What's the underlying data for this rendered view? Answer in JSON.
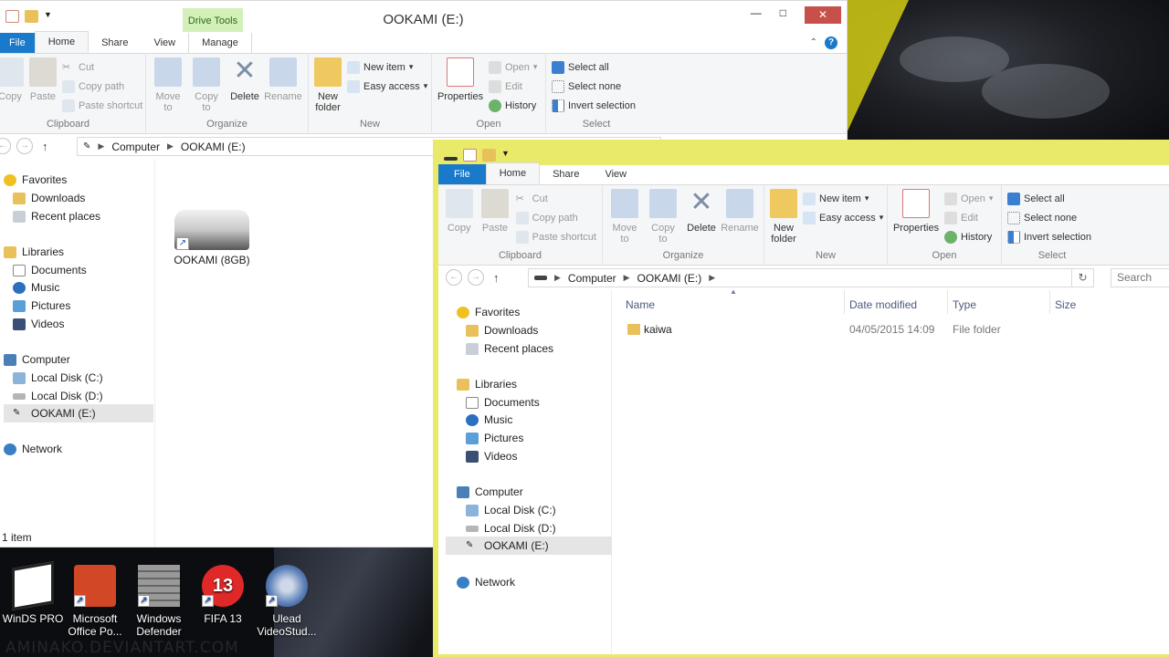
{
  "watermark": "AMINAKO.DEVIANTART.COM",
  "desktop_icons": [
    {
      "label": "WinDS PRO",
      "icon": "winds-pro-icon",
      "color": "#ffffff"
    },
    {
      "label": "Microsoft Office Po...",
      "icon": "powerpoint-icon",
      "color": "#d24726"
    },
    {
      "label": "Windows Defender",
      "icon": "defender-icon",
      "color": "#8a8a8a"
    },
    {
      "label": "FIFA 13",
      "icon": "fifa-icon",
      "color": "#e02828"
    },
    {
      "label": "Ulead VideoStud...",
      "icon": "videostudio-icon",
      "color": "#5a7fb8"
    }
  ],
  "back_window": {
    "title": "OOKAMI (E:)",
    "context_tab": "Drive Tools",
    "tabs": [
      "File",
      "Home",
      "Share",
      "View",
      "Manage"
    ],
    "address": [
      "Computer",
      "OOKAMI (E:)"
    ],
    "drive_label": "OOKAMI (8GB)",
    "status": "1 item"
  },
  "front_window": {
    "tabs": [
      "File",
      "Home",
      "Share",
      "View"
    ],
    "address": [
      "Computer",
      "OOKAMI (E:)"
    ],
    "search_placeholder": "Search",
    "columns": [
      "Name",
      "Date modified",
      "Type",
      "Size"
    ],
    "rows": [
      {
        "name": "kaiwa",
        "modified": "04/05/2015 14:09",
        "type": "File folder",
        "size": ""
      }
    ]
  },
  "ribbon": {
    "clipboard": {
      "label": "Clipboard",
      "copy": "Copy",
      "paste": "Paste",
      "cut": "Cut",
      "copy_path": "Copy path",
      "paste_shortcut": "Paste shortcut"
    },
    "organize": {
      "label": "Organize",
      "move_to": "Move to",
      "copy_to": "Copy to",
      "delete": "Delete",
      "rename": "Rename"
    },
    "new": {
      "label": "New",
      "new_folder": "New folder",
      "new_item": "New item",
      "easy_access": "Easy access"
    },
    "open": {
      "label": "Open",
      "properties": "Properties",
      "open": "Open",
      "edit": "Edit",
      "history": "History"
    },
    "select": {
      "label": "Select",
      "select_all": "Select all",
      "select_none": "Select none",
      "invert": "Invert selection"
    }
  },
  "nav": {
    "favorites": "Favorites",
    "downloads": "Downloads",
    "recent": "Recent places",
    "libraries": "Libraries",
    "documents": "Documents",
    "music": "Music",
    "pictures": "Pictures",
    "videos": "Videos",
    "computer": "Computer",
    "local_c": "Local Disk (C:)",
    "local_d": "Local Disk (D:)",
    "ookami": "OOKAMI (E:)",
    "network": "Network"
  },
  "colors": {
    "file_tab": "#1979ca",
    "drive_tools": "#d3f0b9",
    "front_frame": "#eaea6a",
    "close": "#c7504b"
  }
}
